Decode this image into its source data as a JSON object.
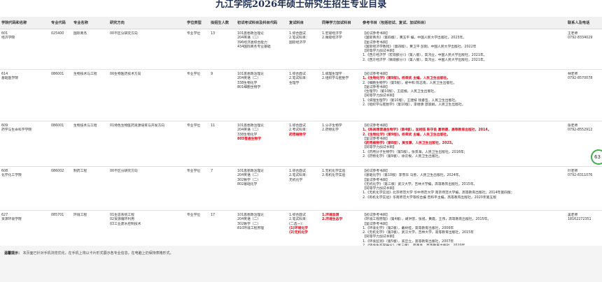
{
  "title": "九江学院2026年硕士研究生招生专业目录",
  "headers": [
    "学院代码和名称",
    "专业代码",
    "专业名称",
    "研究方向",
    "学位类型",
    "拟招生人数",
    "初试考试科目及科目代码",
    "复试科目",
    "同等学力加试科目",
    "参考书目（包括初试、复试、加试科目）",
    "联系人及电话"
  ],
  "rows": [
    {
      "college": [
        "601",
        "经济学院"
      ],
      "code": "025400",
      "major": "国际商务",
      "directions": [
        "00不区分研究方向"
      ],
      "degree": "专业学位",
      "quota": "13",
      "exams": [
        "101思想政治理论",
        "204英语（二）",
        "396经济类综合能力",
        "434国际商务专业基础"
      ],
      "retest": [
        "1.综合面试",
        "2.笔试科目：",
        "国际经济学"
      ],
      "extra": [
        "1.宏观经济学",
        "2.微观经济学"
      ],
      "books": [
        {
          "t": "【初试参考书目】",
          "s": ""
        },
        {
          "t": "《国际商务》（第四版），黄玉平 编，中国人民大学出版社，2023年。",
          "s": ""
        },
        {
          "t": "【复试参考书目】",
          "s": ""
        },
        {
          "t": "《国际经济学教程》（第四版），黄卫平 彭刚，中国人民大学出版社，2022年",
          "s": ""
        },
        {
          "t": "【同等学力加试书目】",
          "s": ""
        },
        {
          "t": "1.《西方经济学（宏观部分）》（第八版），高鸿业，中国人民大学出版社，2021年。",
          "s": ""
        },
        {
          "t": "2.《西方经济学（微观部分）》（第八版），高鸿业，中国人民大学出版社，2021年。",
          "s": ""
        }
      ],
      "contact": [
        "王老师",
        "0792-8334029"
      ]
    },
    {
      "college": [
        "614",
        "基础医学院"
      ],
      "code": "086001",
      "major": "生物技术与工程",
      "directions": [
        "00生物医药技术方向"
      ],
      "degree": "专业学位",
      "quota": "9",
      "exams": [
        "101思想政治理论",
        "204英语（二）",
        "338生物化学",
        "801细胞生物学"
      ],
      "retest": [
        "1.综合面试",
        "2.笔试科目：",
        "生理学"
      ],
      "extra": [
        "1.病理生理学",
        "2.组织学与胚胎学"
      ],
      "books": [
        {
          "t": "【初试参考书目】",
          "s": ""
        },
        {
          "t": "1.《生物化学》(第9版)，杨荣武 主编，人民卫生出版社。",
          "s": "red"
        },
        {
          "t": "2.《细胞生物学》（第5版），翟中和 陈志南，人民卫生出版社。",
          "s": ""
        },
        {
          "t": "【复试参考书目】",
          "s": ""
        },
        {
          "t": "《生理学》（第10版），王庭槐，人民卫生出版社。",
          "s": ""
        },
        {
          "t": "【同等学力加试书目】",
          "s": ""
        },
        {
          "t": "1.《病理生理学》（第10版），王建枝 钱睿哲，人民卫生出版社。",
          "s": ""
        },
        {
          "t": "2.《组织学与胚胎学》（第10版），李继承 邵淑娟，人民卫生出版社。",
          "s": ""
        }
      ],
      "contact": [
        "林老师",
        "0792-8570078"
      ]
    },
    {
      "college": [
        "609",
        "药学与生命科学学院"
      ],
      "code": "086001",
      "major": "生物技术与工程",
      "directions": [
        "01特色生物医药资源培育与开发方向"
      ],
      "degree": "专业学位",
      "quota": "11",
      "exams": [
        "101思想政治理论",
        "204英语（二）",
        "338生物化学",
        "803普通生物学"
      ],
      "exams_red_index": 3,
      "retest": [
        "1.综合面试",
        "2.考试科目：",
        "药用植物学"
      ],
      "retest_red_index": 2,
      "extra": [
        "1.分子生物学",
        "2.药物化学"
      ],
      "books": [
        {
          "t": "【初试参考书目】",
          "s": ""
        },
        {
          "t": "1.《陈阅增普通生物学》（第4版），吴相钰 陈守良 葛明德，高等教育出版社，2014。",
          "s": "red"
        },
        {
          "t": "2.《生物化学》(第9版)，杨荣武 主编，人民卫生出版社。",
          "s": "red"
        },
        {
          "t": "【复试参考书目】",
          "s": ""
        },
        {
          "t": "《药用植物学》（第8版），黄宝康，人民卫生出版社，2023。",
          "s": "red"
        },
        {
          "t": "【同等学力加试书目】",
          "s": ""
        },
        {
          "t": "1.《药用分子生物学》（第5版），张景海，人民卫生出版社，2016年；",
          "s": ""
        },
        {
          "t": "2.《药物化学》（第9版），徐云根，人民卫生出版社。",
          "s": ""
        }
      ],
      "contact": [
        "张老师",
        "0792-8552912"
      ]
    },
    {
      "college": [
        "608",
        "化学化工学院"
      ],
      "code": "086002",
      "major": "制药工程",
      "directions": [
        "00不区分研究方向"
      ],
      "degree": "专业学位",
      "quota": "7",
      "exams": [
        "101思想政治理论",
        "204英语（二）",
        "302数学（二）",
        "802基础化学"
      ],
      "retest": [
        "1.综合面试",
        "2.笔试科目：",
        "无机化学"
      ],
      "extra": [
        "1.无机化学实验",
        "2.有机化学实验"
      ],
      "books": [
        {
          "t": "【初试参考书目】",
          "s": ""
        },
        {
          "t": "《基础化学》（第10版）李雪华 马善，人民卫生出版社，2024年。",
          "s": ""
        },
        {
          "t": "【复试参考书目】",
          "s": ""
        },
        {
          "t": "《无机化学》（第三版）武汉大学，吉林大学编，高等教育出版社，2015年。",
          "s": ""
        },
        {
          "t": "【同等学力加试书目】",
          "s": ""
        },
        {
          "t": "1.《无机化学实验》北京师范大学 华中师范大学 南京师范大学编，高等教育出版社，2014年第四版；",
          "s": ""
        },
        {
          "t": "2.《有机化学实验》华南师范大学等校合编 曾和平主编，高等教育出版社，2020年第五版",
          "s": ""
        }
      ],
      "contact": [
        "叶老师",
        "0792-8311076"
      ]
    },
    {
      "college": [
        "627",
        "资源环境学院"
      ],
      "code": "085701",
      "major": "环境工程",
      "directions": [
        "01生态系统工程",
        "02资源循环利用",
        "03工业废水控制技术"
      ],
      "degree": "专业学位",
      "quota": "17",
      "exams": [
        "101思想政治理论",
        "204英语（二）",
        "302数学（二）",
        "810环境工程原理"
      ],
      "retest": [
        "1.综合面试",
        "2.笔试科目：",
        "(二选一)：",
        "(1)环境化学",
        "(2)无机化学"
      ],
      "retest_red_from": 3,
      "extra": [
        "1.环境监测",
        "2.环境生态学"
      ],
      "extra_red": true,
      "books": [
        {
          "t": "【初试参考书目】",
          "s": ""
        },
        {
          "t": "《环境工程原理》（第4版），胡洪营，张旭，黄霞，王伟，高等教育出版社，2015年。",
          "s": ""
        },
        {
          "t": "【复试参考书目】",
          "s": ""
        },
        {
          "t": "1.《环境化学》（第2版），戴树桂，高等教育出版社，2006年",
          "s": ""
        },
        {
          "t": "2.《无机化学》（第3版），武汉大学，吉林大学，高等教育出版社，2015年",
          "s": ""
        },
        {
          "t": "【同等学力加试书目】",
          "s": ""
        },
        {
          "t": "1.《环境监测》（第5版），奚旦立，高等教育出版社，2007年",
          "s": ""
        },
        {
          "t": "2.《环境生态学导论》（第三版），盛连喜，高等教育出版社，2020年",
          "s": ""
        }
      ],
      "contact": [
        "吴老师",
        "18162272351"
      ]
    }
  ],
  "notice": {
    "label": "温馨提示：",
    "text": "本页面已针对手机浏览优化，在手机上将以卡片形式展示各专业信息，在电脑上仍保持表格形式。"
  },
  "widget": {
    "value": "63"
  },
  "colors": {
    "accent_red": "#e60012",
    "title": "#1f2f55",
    "header_bg": "#f1f1f1"
  }
}
